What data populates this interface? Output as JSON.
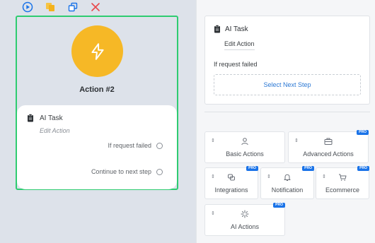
{
  "canvas": {
    "node": {
      "title": "Action #2",
      "task_label": "AI Task",
      "edit_label": "Edit Action",
      "failed_label": "If request failed",
      "continue_label": "Continue to next step"
    }
  },
  "panel": {
    "task_label": "AI Task",
    "edit_label": "Edit Action",
    "failed_label": "If request failed",
    "select_label": "Select Next Step",
    "drag_glyph": "⇕",
    "pro_label": "PRO",
    "tiles": {
      "basic": "Basic Actions",
      "advanced": "Advanced Actions",
      "integrations": "Integrations",
      "notification": "Notification",
      "ecommerce": "Ecommerce",
      "ai": "AI Actions"
    }
  },
  "colors": {
    "accent": "#2ecc71",
    "node_fill": "#f6b826",
    "link": "#2b78d4",
    "pro_badge": "#1a73e8"
  }
}
